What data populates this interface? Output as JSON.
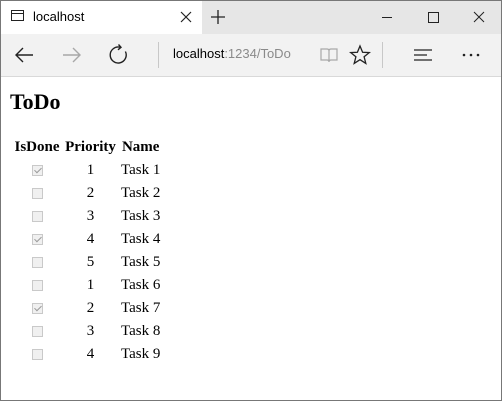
{
  "browser": {
    "tab_title": "localhost",
    "url_host": "localhost",
    "url_rest": ":1234/ToDo"
  },
  "icons": {
    "tab": "page-icon",
    "close_tab": "close-icon",
    "new_tab": "plus-icon",
    "minimize": "minimize-icon",
    "maximize": "maximize-icon",
    "close_window": "close-icon",
    "back": "arrow-left-icon",
    "forward": "arrow-right-icon",
    "refresh": "refresh-icon",
    "reading_view": "book-icon",
    "favorite": "star-icon",
    "hub": "hub-icon",
    "more": "more-icon"
  },
  "page": {
    "title": "ToDo",
    "columns": [
      "IsDone",
      "Priority",
      "Name"
    ],
    "rows": [
      {
        "done": true,
        "priority": "1",
        "name": "Task 1"
      },
      {
        "done": false,
        "priority": "2",
        "name": "Task 2"
      },
      {
        "done": false,
        "priority": "3",
        "name": "Task 3"
      },
      {
        "done": true,
        "priority": "4",
        "name": "Task 4"
      },
      {
        "done": false,
        "priority": "5",
        "name": "Task 5"
      },
      {
        "done": false,
        "priority": "1",
        "name": "Task 6"
      },
      {
        "done": true,
        "priority": "2",
        "name": "Task 7"
      },
      {
        "done": false,
        "priority": "3",
        "name": "Task 8"
      },
      {
        "done": false,
        "priority": "4",
        "name": "Task 9"
      }
    ]
  }
}
